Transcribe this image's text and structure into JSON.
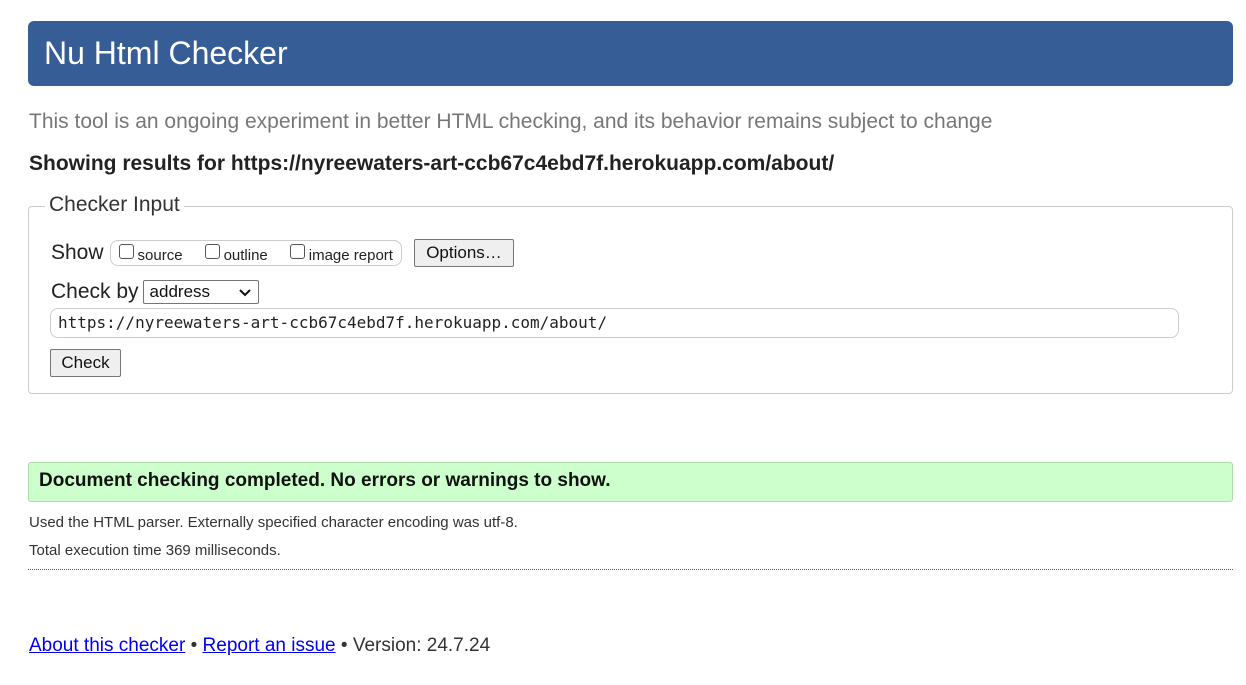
{
  "header": {
    "title": "Nu Html Checker"
  },
  "tagline": "This tool is an ongoing experiment in better HTML checking, and its behavior remains subject to change",
  "results_line": "Showing results for https://nyreewaters-art-ccb67c4ebd7f.herokuapp.com/about/",
  "checker_input": {
    "legend": "Checker Input",
    "show_label": "Show",
    "show_options": [
      {
        "label": "source",
        "checked": false
      },
      {
        "label": "outline",
        "checked": false
      },
      {
        "label": "image report",
        "checked": false
      }
    ],
    "options_button": "Options…",
    "check_by_label": "Check by",
    "check_by_selected": "address",
    "url_value": "https://nyreewaters-art-ccb67c4ebd7f.herokuapp.com/about/",
    "check_button": "Check"
  },
  "result": {
    "message": "Document checking completed. No errors or warnings to show.",
    "parser_info": "Used the HTML parser. Externally specified character encoding was utf-8.",
    "execution_time": "Total execution time 369 milliseconds."
  },
  "footer": {
    "about_link": "About this checker",
    "separator": "•",
    "report_link": "Report an issue",
    "version": "Version: 24.7.24"
  },
  "colors": {
    "header_bg": "#365d95",
    "success_bg": "#ccffcc",
    "link": "#0000ee"
  },
  "icons": {
    "select_arrow": "chevron-down-icon"
  }
}
